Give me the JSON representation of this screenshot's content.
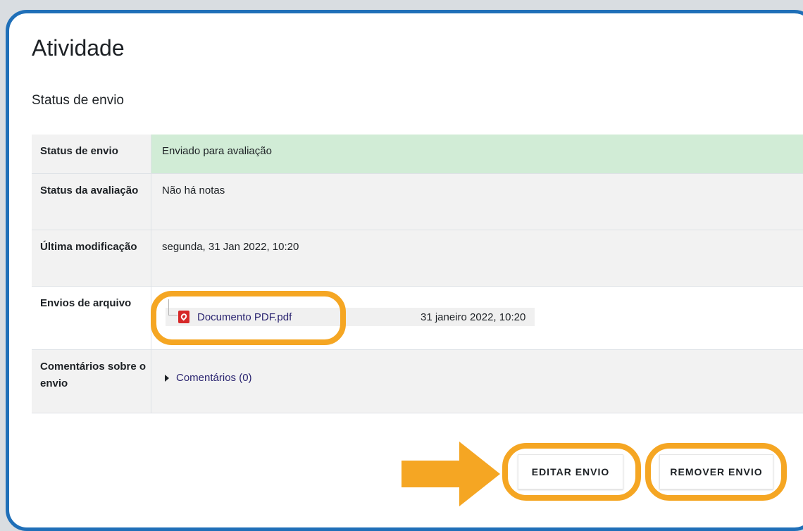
{
  "page": {
    "title": "Atividade",
    "subtitle": "Status de envio"
  },
  "table": {
    "rows": [
      {
        "label": "Status de envio",
        "value": "Enviado para avaliação"
      },
      {
        "label": "Status da avaliação",
        "value": "Não há notas"
      },
      {
        "label": "Última modificação",
        "value": "segunda, 31 Jan 2022, 10:20"
      },
      {
        "label": "Envios de arquivo",
        "value": ""
      },
      {
        "label": "Comentários sobre o envio",
        "value": ""
      }
    ]
  },
  "files": {
    "name": "Documento PDF.pdf",
    "date": "31 janeiro 2022, 10:20",
    "icon": "pdf-icon"
  },
  "comments": {
    "link": "Comentários (0)"
  },
  "actions": {
    "edit": "EDITAR ENVIO",
    "remove": "REMOVER ENVIO"
  },
  "colors": {
    "highlight": "#f5a623",
    "frame": "#1f6fb8",
    "success": "#d1ecd6",
    "link": "#2a2470"
  }
}
